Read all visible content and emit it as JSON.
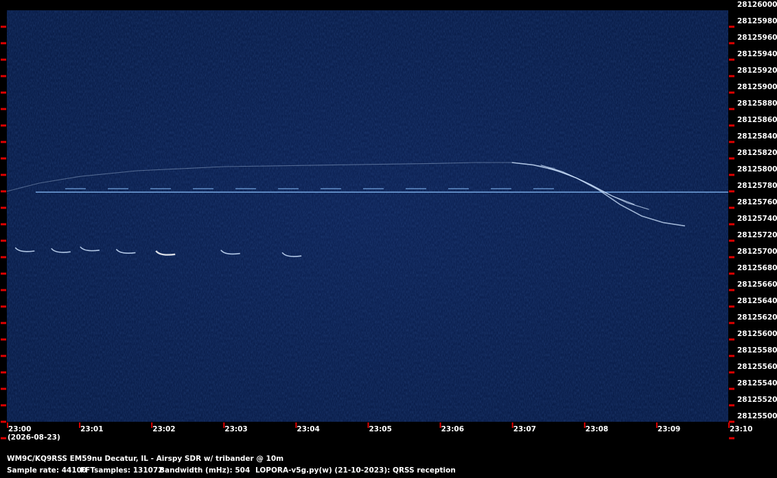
{
  "colors": {
    "background": "#000000",
    "waterfall": "#0a1f4d",
    "tick": "#e00000",
    "signal": "#cfe4ff"
  },
  "chart_data": {
    "type": "heatmap",
    "y_ticks": [
      "28126000",
      "28125980",
      "28125960",
      "28125940",
      "28125920",
      "28125900",
      "28125880",
      "28125860",
      "28125840",
      "28125820",
      "28125800",
      "28125780",
      "28125760",
      "28125740",
      "28125720",
      "28125700",
      "28125680",
      "28125660",
      "28125640",
      "28125620",
      "28125600",
      "28125580",
      "28125560",
      "28125540",
      "28125520",
      "28125500"
    ],
    "ylim": [
      28125500,
      28126000
    ],
    "x_ticks": [
      "23:00",
      "23:01",
      "23:02",
      "23:03",
      "23:04",
      "23:05",
      "23:06",
      "23:07",
      "23:08",
      "23:09",
      "23:10"
    ],
    "x_date": "(2026-08-23)",
    "carrier_frequency": 28125779,
    "traces": [
      {
        "x": [
          0.0,
          0.45,
          1.0,
          1.8,
          3.0,
          4.5,
          6.0,
          6.5,
          7.0,
          7.3,
          7.6
        ],
        "y": [
          28125780,
          28125790,
          28125798,
          28125805,
          28125810,
          28125812,
          28125814,
          28125815,
          28125815,
          28125812,
          28125808
        ]
      },
      {
        "x": [
          7.0,
          7.3,
          7.6,
          7.9,
          8.2,
          8.5,
          8.8,
          9.1,
          9.4
        ],
        "y": [
          28125815,
          28125812,
          28125806,
          28125796,
          28125782,
          28125764,
          28125750,
          28125742,
          28125738
        ]
      },
      {
        "x": [
          7.4,
          7.7,
          8.0,
          8.3,
          8.6,
          8.9
        ],
        "y": [
          28125812,
          28125804,
          28125792,
          28125778,
          28125766,
          28125758
        ]
      },
      {
        "x": [
          7.5,
          7.8,
          8.1,
          8.4,
          8.7
        ],
        "y": [
          28125808,
          28125800,
          28125788,
          28125774,
          28125764
        ]
      }
    ],
    "bursts": [
      {
        "x": 0.25,
        "y": 28125705
      },
      {
        "x": 0.75,
        "y": 28125704
      },
      {
        "x": 1.15,
        "y": 28125706
      },
      {
        "x": 1.65,
        "y": 28125703
      },
      {
        "x": 2.2,
        "y": 28125701
      },
      {
        "x": 3.1,
        "y": 28125702
      },
      {
        "x": 3.95,
        "y": 28125699
      }
    ]
  },
  "info": {
    "station": "WM9C/KQ9RSS EM59nu Decatur, IL - Airspy SDR w/ tribander @ 10m",
    "sample_rate": "Sample rate: 44100",
    "fft": "FFTsamples: 131072",
    "bandwidth": "Bandwidth (mHz): 504",
    "software": "LOPORA-v5g.py(w) (21-10-2023): QRSS reception"
  }
}
